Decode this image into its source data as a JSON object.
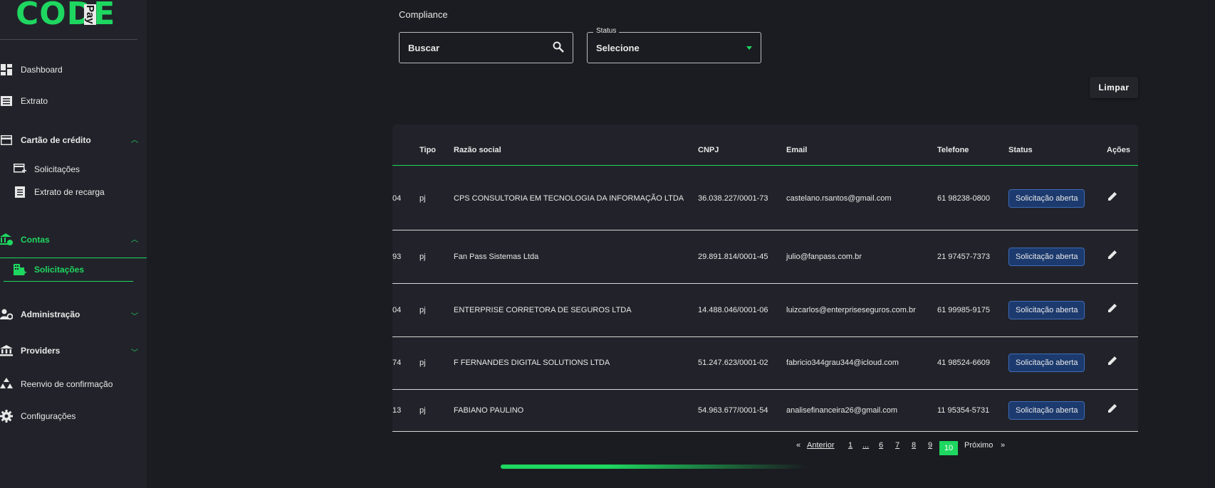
{
  "brand": {
    "name": "CODE",
    "suffix": "Pay",
    "accent": "#1ed760"
  },
  "sidebar": {
    "items": [
      {
        "label": "Dashboard",
        "icon": "dashboard-icon"
      },
      {
        "label": "Extrato",
        "icon": "list-icon"
      },
      {
        "label": "Cartão de crédito",
        "icon": "credit-card-icon",
        "expanded": true,
        "children": [
          {
            "label": "Solicitações",
            "icon": "card-add-icon"
          },
          {
            "label": "Extrato de recarga",
            "icon": "list-icon"
          }
        ]
      },
      {
        "label": "Contas",
        "icon": "bank-account-icon",
        "expanded": true,
        "active": true,
        "children": [
          {
            "label": "Solicitações",
            "icon": "building-add-icon",
            "active": true
          }
        ]
      },
      {
        "label": "Administração",
        "icon": "admin-icon",
        "expanded": false
      },
      {
        "label": "Providers",
        "icon": "bank-icon",
        "expanded": false
      },
      {
        "label": "Reenvio de confirmação",
        "icon": "recycle-icon"
      },
      {
        "label": "Configurações",
        "icon": "gear-icon"
      }
    ]
  },
  "main": {
    "title": "Compliance",
    "search": {
      "value": "Buscar"
    },
    "status_filter": {
      "legend": "Status",
      "value": "Selecione"
    },
    "clear_label": "Limpar"
  },
  "table": {
    "columns": [
      "Tipo",
      "Razão social",
      "CNPJ",
      "Email",
      "Telefone",
      "Status",
      "Ações"
    ],
    "rows": [
      {
        "id_tail": "04",
        "tipo": "pj",
        "razao": "CPS CONSULTORIA EM TECNOLOGIA DA INFORMAÇÃO LTDA",
        "cnpj": "36.038.227/0001-73",
        "email": "castelano.rsantos@gmail.com",
        "telefone": "61 98238-0800",
        "status": "Solicitação aberta"
      },
      {
        "id_tail": "93",
        "tipo": "pj",
        "razao": "Fan Pass Sistemas Ltda",
        "cnpj": "29.891.814/0001-45",
        "email": "julio@fanpass.com.br",
        "telefone": "21 97457-7373",
        "status": "Solicitação aberta"
      },
      {
        "id_tail": "04",
        "tipo": "pj",
        "razao": "ENTERPRISE CORRETORA DE SEGUROS LTDA",
        "cnpj": "14.488.046/0001-06",
        "email": "luizcarlos@enterpriseseguros.com.br",
        "telefone": "61 99985-9175",
        "status": "Solicitação aberta"
      },
      {
        "id_tail": "74",
        "tipo": "pj",
        "razao": "F FERNANDES DIGITAL SOLUTIONS LTDA",
        "cnpj": "51.247.623/0001-02",
        "email": "fabricio344grau344@icloud.com",
        "telefone": "41 98524-6609",
        "status": "Solicitação aberta"
      },
      {
        "id_tail": "13",
        "tipo": "pj",
        "razao": "FABIANO PAULINO",
        "cnpj": "54.963.677/0001-54",
        "email": "analisefinanceira26@gmail.com",
        "telefone": "11 95354-5731",
        "status": "Solicitação aberta"
      }
    ]
  },
  "pagination": {
    "prev_symbol": "«",
    "prev_label": "Anterior",
    "pages": [
      "1",
      "...",
      "6",
      "7",
      "8",
      "9"
    ],
    "current": "10",
    "next_label": "Próximo",
    "next_symbol": "»"
  }
}
